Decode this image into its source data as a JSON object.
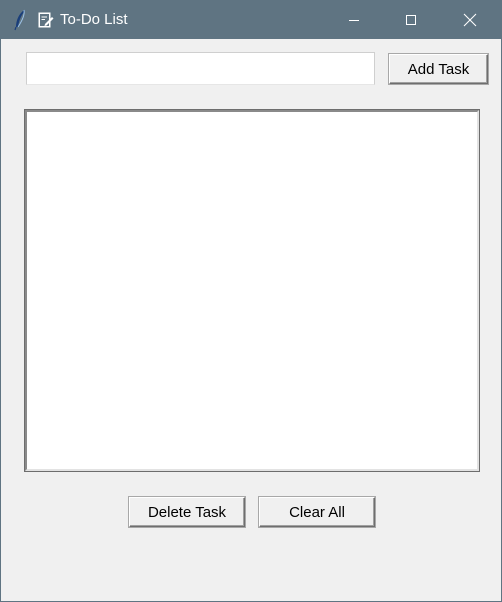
{
  "window": {
    "title": "To-Do List",
    "title_bar_color": "#5f7482",
    "background_color": "#f0f0f0"
  },
  "icons": {
    "app_icon": "tk-feather-icon",
    "document_icon": "notepad-icon",
    "minimize": "minimize-icon",
    "maximize": "maximize-icon",
    "close": "close-icon"
  },
  "task_input": {
    "value": "",
    "placeholder": ""
  },
  "buttons": {
    "add_task": "Add Task",
    "delete_task": "Delete Task",
    "clear_all": "Clear All"
  },
  "task_list": {
    "items": []
  }
}
